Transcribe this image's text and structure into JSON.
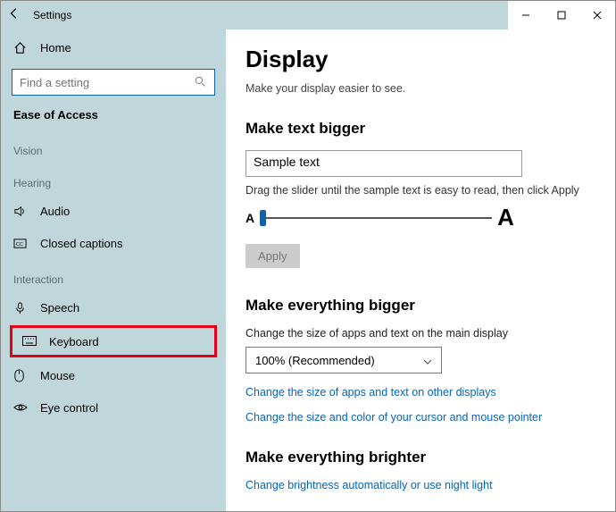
{
  "window": {
    "title": "Settings"
  },
  "sidebar": {
    "home": "Home",
    "search_placeholder": "Find a setting",
    "group": "Ease of Access",
    "vision_label": "Vision",
    "hearing_label": "Hearing",
    "interaction_label": "Interaction",
    "audio": "Audio",
    "cc": "Closed captions",
    "speech": "Speech",
    "keyboard": "Keyboard",
    "mouse": "Mouse",
    "eye": "Eye control"
  },
  "main": {
    "title": "Display",
    "subtitle": "Make your display easier to see.",
    "sec1": "Make text bigger",
    "sample": "Sample text",
    "slider_hint": "Drag the slider until the sample text is easy to read, then click Apply",
    "smallA": "A",
    "bigA": "A",
    "apply": "Apply",
    "sec2": "Make everything bigger",
    "sec2desc": "Change the size of apps and text on the main display",
    "dropdown": "100% (Recommended)",
    "link1": "Change the size of apps and text on other displays",
    "link2": "Change the size and color of your cursor and mouse pointer",
    "sec3": "Make everything brighter",
    "link3": "Change brightness automatically or use night light"
  }
}
